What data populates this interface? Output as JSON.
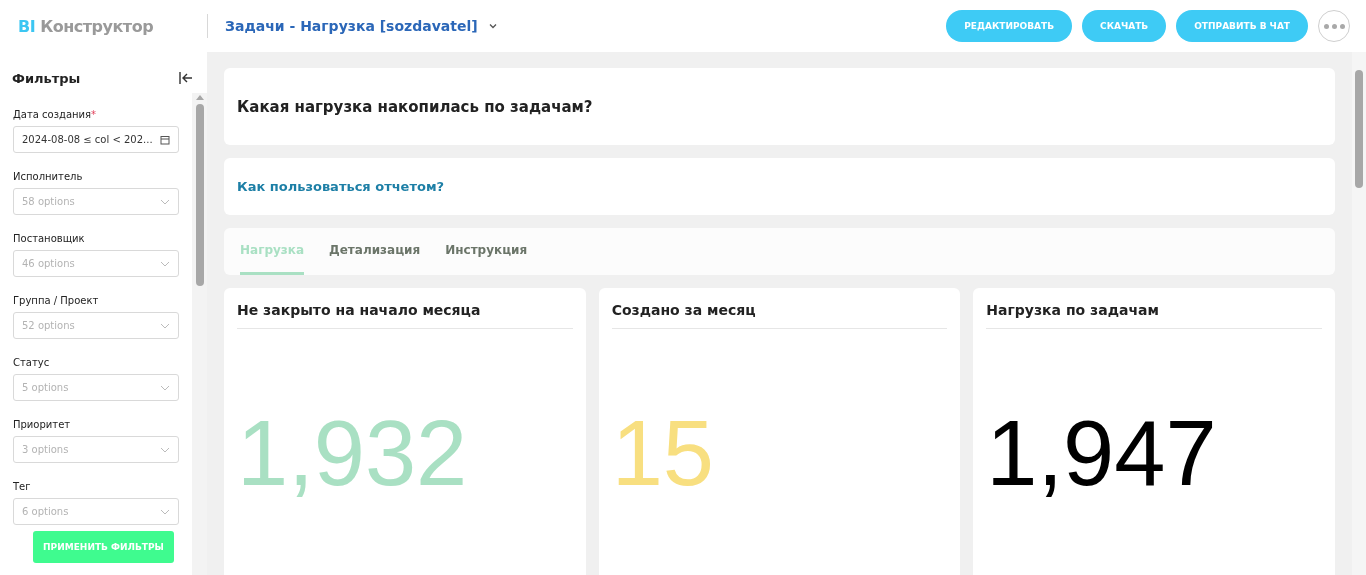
{
  "header": {
    "logo_prefix": "BI",
    "logo_name": "Конструктор",
    "title": "Задачи - Нагрузка [sozdavatel]",
    "buttons": [
      "РЕДАКТИРОВАТЬ",
      "СКАЧАТЬ",
      "ОТПРАВИТЬ В ЧАТ"
    ]
  },
  "sidebar": {
    "title": "Фильтры",
    "filters": [
      {
        "kind": "date",
        "label": "Дата создания",
        "marker": "*",
        "value": "2024-08-08 ≤ col < 202..."
      },
      {
        "kind": "select",
        "label": "Исполнитель",
        "placeholder": "58 options"
      },
      {
        "kind": "select",
        "label": "Постановщик",
        "placeholder": "46 options"
      },
      {
        "kind": "select",
        "label": "Группа / Проект",
        "placeholder": "52 options"
      },
      {
        "kind": "select",
        "label": "Статус",
        "placeholder": "5 options"
      },
      {
        "kind": "select",
        "label": "Приоритет",
        "placeholder": "3 options"
      },
      {
        "kind": "select",
        "label": "Тег",
        "placeholder": "6 options"
      }
    ],
    "apply_button": "ПРИМЕНИТЬ ФИЛЬТРЫ"
  },
  "question": "Какая нагрузка накопилась по задачам?",
  "help_link": "Как пользоваться отчетом?",
  "tabs": [
    {
      "label": "Нагрузка",
      "selected": true
    },
    {
      "label": "Детализация",
      "selected": false
    },
    {
      "label": "Инструкция",
      "selected": false
    }
  ],
  "metrics": [
    {
      "title": "Не закрыто на начало месяца",
      "value": "1,932",
      "color": "#a9e0c3"
    },
    {
      "title": "Создано за месяц",
      "value": "15",
      "color": "#f8df80"
    },
    {
      "title": "Нагрузка по задачам",
      "value": "1,947",
      "color": "#000000"
    }
  ]
}
